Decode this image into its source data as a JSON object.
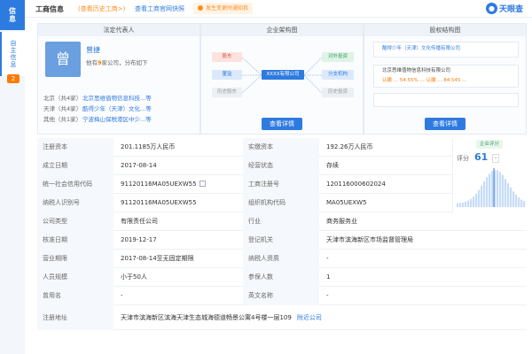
{
  "sidebar": {
    "tab_info": "信息",
    "tab_self": "自主信息",
    "badge": "2"
  },
  "header": {
    "title": "工商信息",
    "history": "(查看历史工商>)",
    "quick_link": "查看工商官网快照",
    "badge": "发生变更时通知我",
    "logo_mark": "●",
    "logo_text": "天眼查"
  },
  "panels": {
    "legal_rep": {
      "heading": "法定代表人",
      "avatar_char": "曾",
      "name": "曾捷",
      "desc_prefix": "他有",
      "desc_count": "9",
      "desc_suffix": "家公司，分布如下",
      "rows": [
        {
          "city": "北京（共4家）",
          "company": "北京思维值物信息科技...等"
        },
        {
          "city": "天津（共4家）",
          "company": "酷得少年（天津）文化...等"
        },
        {
          "city": "其他（共1家）",
          "company": "宁波梅山保税港区中少...等"
        }
      ]
    },
    "structure": {
      "heading": "企业架构图",
      "center": "XXXX有限公司",
      "left": [
        "股东",
        "董监",
        "历史股东"
      ],
      "right": [
        "对外投资",
        "分支机构",
        "历史投资"
      ],
      "button": "查看详情"
    },
    "equity": {
      "heading": "股权结构图",
      "top": "酷得少年（天津）文化传播有限公司",
      "rows": [
        "北京思维值物信息科技有限公司",
        "认缴 ... 54.55%  ... 认缴 ... 84.545 ...",
        ""
      ],
      "button": "查看详情"
    }
  },
  "table": {
    "rows": [
      [
        "注册资本",
        "201.1185万人民币",
        "实缴资本",
        "192.26万人民币"
      ],
      [
        "成立日期",
        "2017-08-14",
        "经营状态",
        "存续"
      ],
      [
        "统一社会信用代码",
        "91120116MA05UEXW55",
        "工商注册号",
        "120116000602024"
      ],
      [
        "纳税人识别号",
        "91120116MA05UEXW55",
        "组织机构代码",
        "MA05UEXW5"
      ],
      [
        "公司类型",
        "有限责任公司",
        "行业",
        "商务服务业"
      ],
      [
        "核准日期",
        "2019-12-17",
        "登记机关",
        "天津市滨海新区市场监督管理局"
      ],
      [
        "营业期限",
        "2017-08-14至无固定期限",
        "纳税人资质",
        "-"
      ],
      [
        "人员规模",
        "小于50人",
        "参保人数",
        "1"
      ],
      [
        "曾用名",
        "-",
        "英文名称",
        "-"
      ]
    ],
    "address_label": "注册地址",
    "address_value": "天津市滨海新区滨海天津生态城海德道畅景公寓4号楼一层109",
    "address_link": "附近公司"
  },
  "score": {
    "badge": "企业评分",
    "label": "评分",
    "value": "61",
    "delta": "-",
    "colors": {
      "primary": "#2e7be0",
      "bar": "#c7dcf7"
    }
  }
}
